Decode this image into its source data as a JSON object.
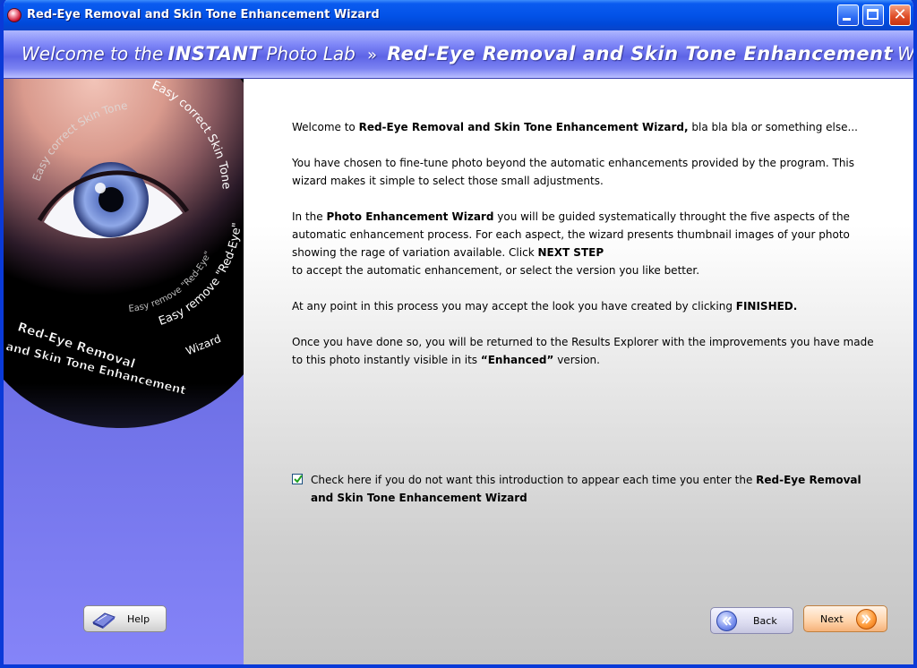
{
  "window": {
    "title": "Red-Eye Removal and Skin Tone Enhancement Wizard",
    "controls": [
      "minimize",
      "maximize",
      "close"
    ]
  },
  "banner": {
    "welcome": "Welcome to the",
    "instant": "INSTANT",
    "photo_lab": "Photo Lab",
    "separator_icon": "double-chevron-right-icon",
    "wizard_name": "Red-Eye Removal and Skin Tone Enhancement",
    "wizard_suffix": "Wizard"
  },
  "side_image": {
    "arc_line_1": "Easy correct Skin Tone",
    "arc_line_2": "Easy correct Skin Tone",
    "arc_line_3": "Easy remove \"Red-Eye\"",
    "arc_line_4": "Easy remove \"Red-Eye\"",
    "title_line_1": "Red-Eye Removal",
    "title_line_2": "and Skin Tone Enhancement",
    "title_suffix": "Wizard"
  },
  "intro": {
    "p1_pre": "Welcome to ",
    "p1_bold": "Red-Eye Removal and Skin Tone Enhancement Wizard,",
    "p1_post": " bla bla bla or something else...",
    "p2": "You have chosen to fine-tune photo beyond the automatic enhancements provided by the program. This wizard makes it simple to select those small adjustments.",
    "p3_pre": "In the ",
    "p3_bold": "Photo Enhancement Wizard",
    "p3_mid": " you will be guided systematically throught the five aspects of the automatic enhancement process. For each aspect, the wizard presents thumbnail images of your photo showing the rage of variation available. Click ",
    "p3_bold2": "NEXT STEP",
    "p3_post": "to accept the automatic enhancement, or select the version you like better.",
    "p4_pre": "At any point in this process you may accept the look you have created by clicking ",
    "p4_bold": "FINISHED.",
    "p5_pre": "Once you have done so, you will be returned to the Results Explorer with the improvements you have made to this photo instantly visible in its ",
    "p5_bold": "“Enhanced”",
    "p5_post": " version."
  },
  "checkbox": {
    "checked": true,
    "label_pre": "Check here if you do not want this introduction to appear each time you enter the ",
    "label_bold": "Red-Eye Removal and Skin Tone Enhancement Wizard"
  },
  "buttons": {
    "help": "Help",
    "back": "Back",
    "next": "Next"
  },
  "colors": {
    "titlebar": "#0353e8",
    "banner": "#6e75ee",
    "side_panel_bottom": "#8584f8"
  }
}
